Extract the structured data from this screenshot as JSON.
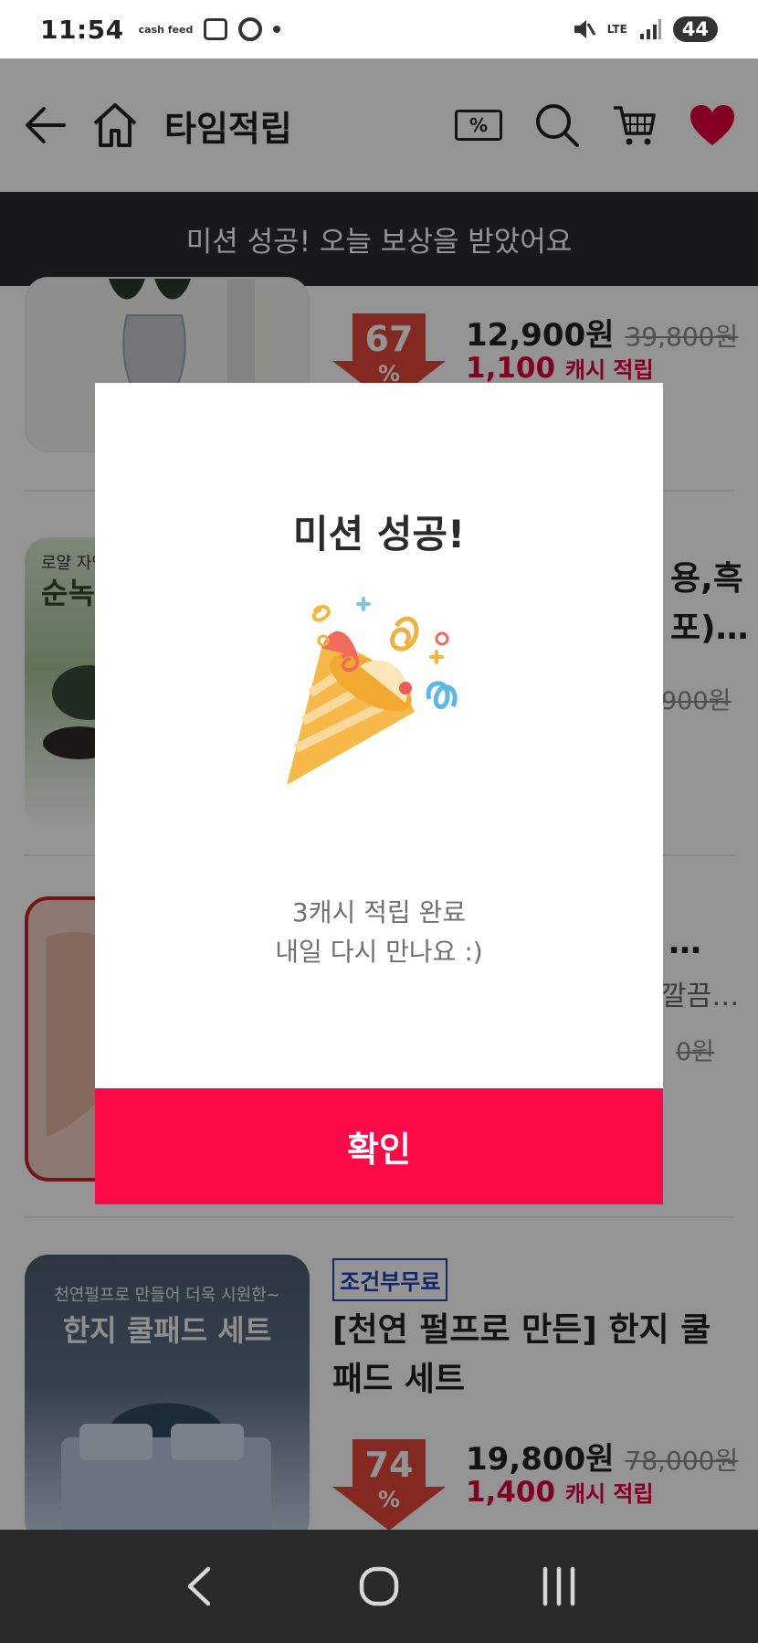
{
  "status_bar": {
    "time": "11:54",
    "app_badge": "cash feed",
    "lte": "LTE",
    "battery": "44"
  },
  "header": {
    "title": "타임적립",
    "coupon_symbol": "%"
  },
  "banner": {
    "text": "미션 성공! 오늘 보상을 받았어요"
  },
  "products": [
    {
      "discount": "67",
      "discount_sign": "%",
      "price": "12,900원",
      "original_price": "39,800원",
      "cash_amount": "1,100",
      "cash_label": "캐시 적립"
    },
    {
      "thumb_text_top": "로얄 자연",
      "thumb_text_main": "순녹",
      "name_fragment_1": "용,흑",
      "name_fragment_2": "포)…",
      "price_fragment": "900원"
    },
    {
      "name_fragment_1": "…",
      "name_fragment_2": "깔끔…",
      "price_fragment": "0원"
    },
    {
      "tag": "조건부무료",
      "thumb_caption_top": "천연펄프로 만들어 더욱 시원한~",
      "thumb_caption_main": "한지 쿨패드 세트",
      "name_line1": "[천연 펄프로 만든] 한지 쿨",
      "name_line2": "패드 세트",
      "discount": "74",
      "discount_sign": "%",
      "price": "19,800원",
      "original_price": "78,000원",
      "cash_amount": "1,400",
      "cash_label": "캐시 적립"
    }
  ],
  "modal": {
    "title": "미션 성공!",
    "message_line1": "3캐시 적립 완료",
    "message_line2": "내일 다시 만나요 :)",
    "confirm_label": "확인"
  },
  "colors": {
    "accent": "#fa0a47",
    "cash_red": "#e4003c",
    "banner_bg": "#2a2b2e",
    "discount_arrow": "#e2483c",
    "tag_blue": "#2343b8"
  }
}
